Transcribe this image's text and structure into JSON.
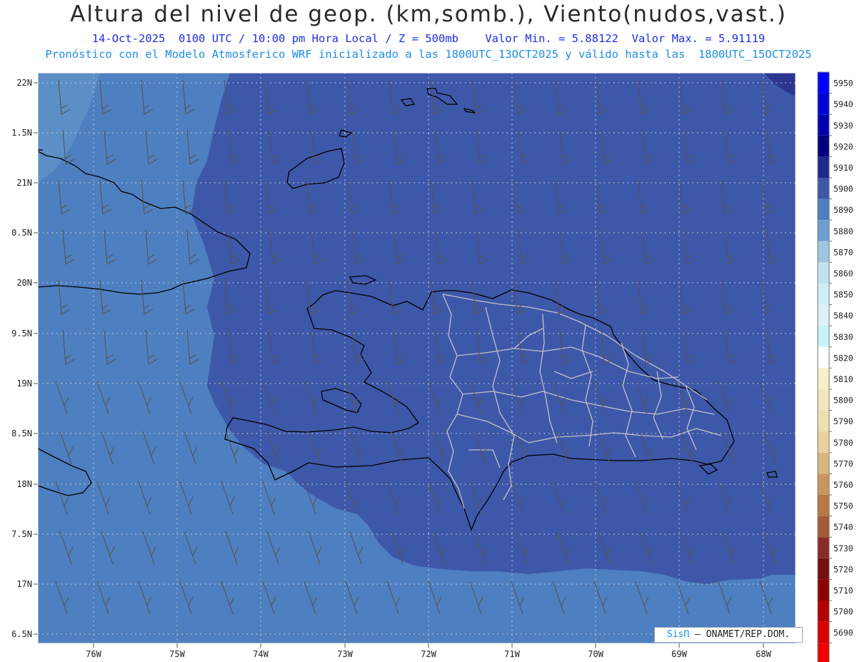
{
  "header": {
    "title": "Altura del nivel de geop. (km,somb.), Viento(nudos,vast.)",
    "info_line": "14-Oct-2025  0100 UTC / 10:00 pm Hora Local / Z = 500mb    Valor Min. = 5.88122  Valor Max. = 5.91119",
    "model_line": "Pronóstico con el Modelo Atmosferico WRF inicializado a las 1800UTC_13OCT2025 y válido hasta las  1800UTC_15OCT2025"
  },
  "map": {
    "latitude_labels": [
      "22N",
      "1.5N",
      "21N",
      "0.5N",
      "20N",
      "9.5N",
      "19N",
      "8.5N",
      "18N",
      "7.5N",
      "17N",
      "6.5N"
    ],
    "longitude_labels": [
      "76W",
      "75W",
      "74W",
      "73W",
      "72W",
      "71W",
      "70W",
      "69W",
      "68W"
    ],
    "fill_colors": {
      "level_5880": "#5b8fc6",
      "level_5890": "#4e7fc0",
      "level_5900": "#3d58a9",
      "level_5910": "#2c3690"
    }
  },
  "colorbar": {
    "levels": [
      "5950",
      "5940",
      "5930",
      "5920",
      "5910",
      "5900",
      "5890",
      "5880",
      "5870",
      "5860",
      "5850",
      "5840",
      "5830",
      "5820",
      "5810",
      "5800",
      "5790",
      "5780",
      "5770",
      "5760",
      "5750",
      "5740",
      "5730",
      "5720",
      "5710",
      "5700",
      "5690"
    ],
    "colors": [
      "#0000ff",
      "#0000d8",
      "#0000b0",
      "#000080",
      "#1d2a8c",
      "#3d58a9",
      "#4e7fc0",
      "#6f9fd0",
      "#9ec6e2",
      "#bfe2ef",
      "#cfeef4",
      "#dcf2f8",
      "#c6f4f7",
      "#ffffff",
      "#f6efc8",
      "#f1e6bb",
      "#eedfb0",
      "#e9d09e",
      "#dbb57e",
      "#c99660",
      "#b77845",
      "#a45a36",
      "#8a2a26",
      "#740f14",
      "#8c0000",
      "#b40000",
      "#d80000",
      "#f00000"
    ]
  },
  "credit": {
    "brand": "SisΠ",
    "text": " – ONAMET/REP.DOM."
  }
}
